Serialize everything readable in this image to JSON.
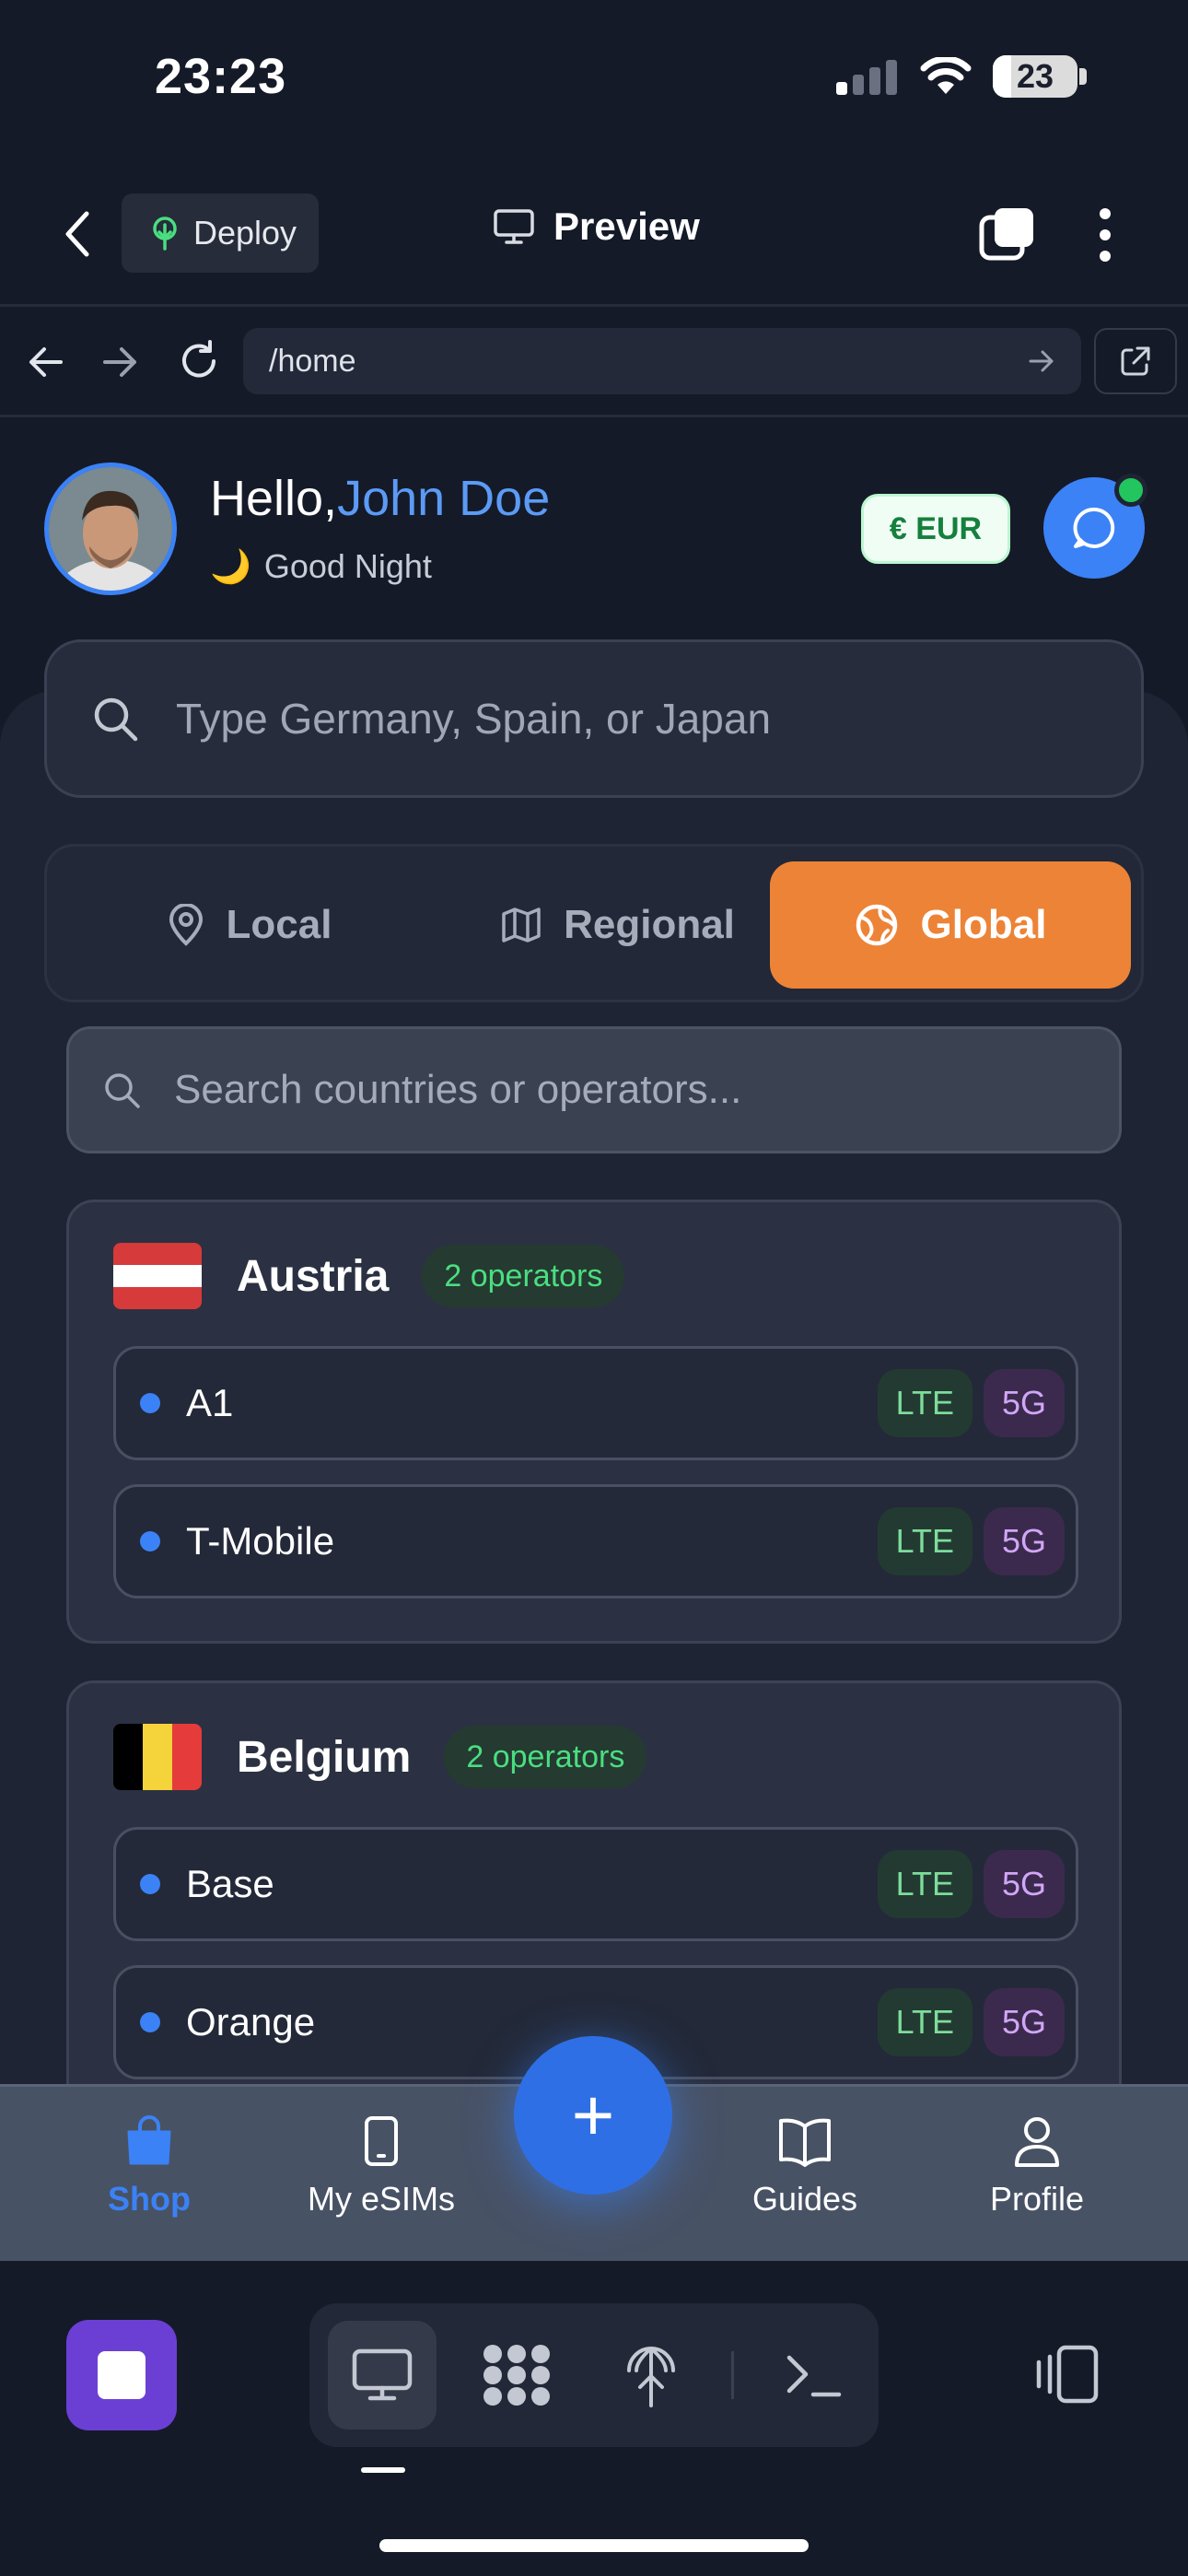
{
  "status_bar": {
    "time": "23:23",
    "battery": "23"
  },
  "header": {
    "deploy_label": "Deploy",
    "preview_label": "Preview"
  },
  "browser": {
    "url": "/home"
  },
  "greeting": {
    "hello": "Hello,",
    "name": "John Doe",
    "moon": "🌙",
    "subtitle": "Good Night",
    "currency": "€ EUR"
  },
  "search": {
    "placeholder": "Type Germany, Spain, or Japan"
  },
  "tabs": {
    "local": "Local",
    "regional": "Regional",
    "global": "Global",
    "selected": "Global"
  },
  "operator_search": {
    "placeholder": "Search countries or operators..."
  },
  "countries": [
    {
      "name": "Austria",
      "operators_badge": "2 operators",
      "flag_colors": [
        "#d73a3a",
        "#ffffff",
        "#d73a3a"
      ],
      "operators": [
        {
          "name": "A1",
          "tags": [
            "LTE",
            "5G"
          ]
        },
        {
          "name": "T-Mobile",
          "tags": [
            "LTE",
            "5G"
          ]
        }
      ]
    },
    {
      "name": "Belgium",
      "operators_badge": "2 operators",
      "flag_colors": [
        "#000000",
        "#f5d33a",
        "#e63b3b"
      ],
      "operators": [
        {
          "name": "Base",
          "tags": [
            "LTE",
            "5G"
          ]
        },
        {
          "name": "Orange",
          "tags": [
            "LTE",
            "5G"
          ]
        }
      ]
    }
  ],
  "bottom_nav": {
    "items": [
      {
        "label": "Shop",
        "icon": "shopping-bag-icon",
        "active": true
      },
      {
        "label": "My eSIMs",
        "icon": "phone-icon",
        "active": false
      },
      {
        "label": "Guides",
        "icon": "book-icon",
        "active": false
      },
      {
        "label": "Profile",
        "icon": "user-icon",
        "active": false
      }
    ],
    "fab": "+"
  },
  "colors": {
    "accent_blue": "#3b82f6",
    "accent_orange": "#ed8336",
    "background": "#151a28"
  }
}
